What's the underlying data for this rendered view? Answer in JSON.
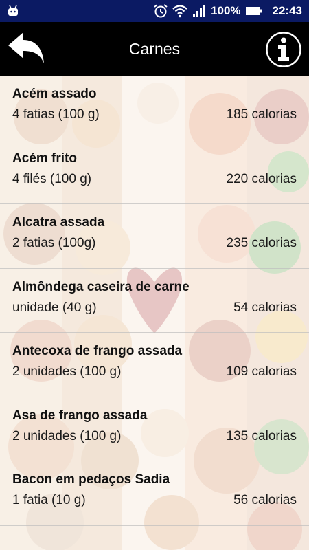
{
  "status_bar": {
    "battery_percent": "100%",
    "time": "22:43"
  },
  "header": {
    "title": "Carnes"
  },
  "items": [
    {
      "name": "Acém assado",
      "portion": "4 fatias (100 g)",
      "calories": "185 calorias"
    },
    {
      "name": "Acém frito",
      "portion": "4 filés (100 g)",
      "calories": "220 calorias"
    },
    {
      "name": "Alcatra assada",
      "portion": "2 fatias (100g)",
      "calories": "235 calorias"
    },
    {
      "name": "Almôndega caseira de carne",
      "portion": "unidade (40 g)",
      "calories": "54 calorias"
    },
    {
      "name": "Antecoxa de frango assada",
      "portion": "2 unidades (100 g)",
      "calories": "109 calorias"
    },
    {
      "name": "Asa de frango assada",
      "portion": "2 unidades (100 g)",
      "calories": "135 calorias"
    },
    {
      "name": "Bacon em pedaços Sadia",
      "portion": "1 fatia (10 g)",
      "calories": "56 calorias"
    }
  ],
  "colors": {
    "status_bar": "#0b1a63",
    "header": "#000000"
  }
}
